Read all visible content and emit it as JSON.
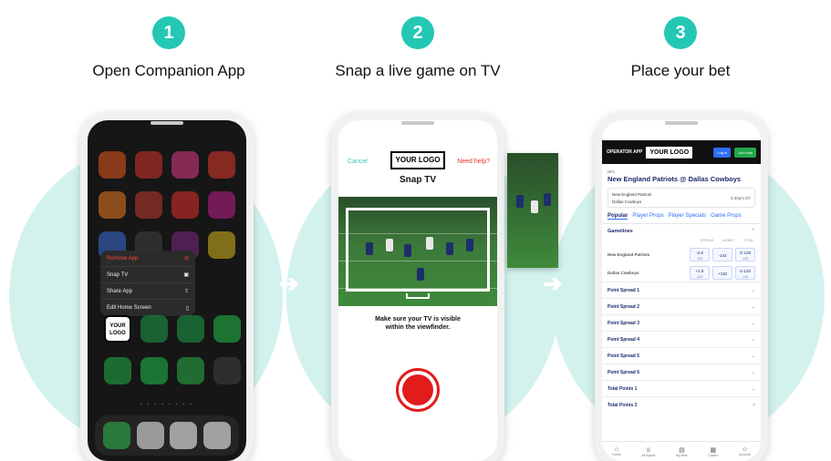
{
  "steps": [
    {
      "number": "1",
      "title": "Open Companion App"
    },
    {
      "number": "2",
      "title": "Snap a live game on TV"
    },
    {
      "number": "3",
      "title": "Place your bet"
    }
  ],
  "phone1": {
    "context_menu": [
      {
        "label": "Remove App",
        "icon": "minus-circle-icon"
      },
      {
        "label": "Snap TV",
        "icon": "camera-icon"
      },
      {
        "label": "Share App",
        "icon": "share-icon"
      },
      {
        "label": "Edit Home Screen",
        "icon": "phone-icon"
      }
    ],
    "app_tile_line1": "YOUR",
    "app_tile_line2": "LOGO"
  },
  "phone2": {
    "cancel": "Cancel",
    "logo": "YOUR LOGO",
    "help": "Need help?",
    "title": "Snap TV",
    "message_line1": "Make sure your TV is visible",
    "message_line2": "within the viewfinder."
  },
  "phone3": {
    "operator_label": "OPERATOR APP",
    "logo": "YOUR LOGO",
    "login": "Log in",
    "join": "Join now",
    "league": "NFL",
    "matchup": "New England Patriots @ Dallas Cowboys",
    "team1": "New England Patriots",
    "team2": "Dallas Cowboys",
    "time": "6:30pm ET",
    "tabs": [
      "Popular",
      "Player Props",
      "Player Specials",
      "Game Props"
    ],
    "gamelines_title": "Gamelines",
    "col_heads": [
      "SPREAD",
      "MONEY",
      "TOTAL"
    ],
    "odds": [
      {
        "team": "New England Patriots",
        "spread": "-2.5",
        "spread_sub": "-110",
        "money": "-142",
        "total": "O 120",
        "total_sub": "-110"
      },
      {
        "team": "Dallas Cowboys",
        "spread": "+2.5",
        "spread_sub": "-110",
        "money": "+118",
        "total": "U 120",
        "total_sub": "-110"
      }
    ],
    "markets": [
      "Point Spread 1",
      "Point Spread 2",
      "Point Spread 3",
      "Point Spread 4",
      "Point Spread 5",
      "Point Spread 6",
      "Total Points 1",
      "Total Points 2"
    ],
    "nav": [
      {
        "label": "Home",
        "icon": "home-icon"
      },
      {
        "label": "All Sports",
        "icon": "trophy-icon"
      },
      {
        "label": "My Bets",
        "icon": "ticket-icon"
      },
      {
        "label": "Casino",
        "icon": "cards-icon"
      },
      {
        "label": "Account",
        "icon": "user-icon"
      }
    ]
  },
  "colors": {
    "accent_teal": "#23c7b4",
    "bg_circle": "#d3f2ee",
    "snap_red": "#e21b1b",
    "link_blue": "#2f6df2",
    "join_green": "#22a84a",
    "navy": "#1d2a6b"
  }
}
